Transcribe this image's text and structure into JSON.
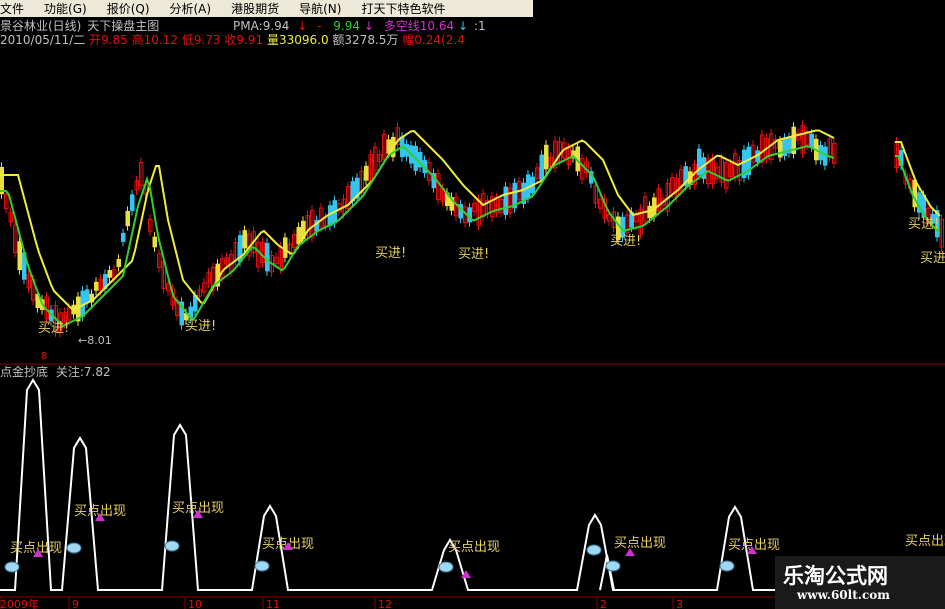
{
  "menu": [
    {
      "label": "文件",
      "name": "menu-file",
      "width": 0
    },
    {
      "label": "功能(G)",
      "name": "menu-function"
    },
    {
      "label": "报价(Q)",
      "name": "menu-quote"
    },
    {
      "label": "分析(A)",
      "name": "menu-analysis"
    },
    {
      "label": "港股期货",
      "name": "menu-hk-futures"
    },
    {
      "label": "导航(N)",
      "name": "menu-navigation"
    },
    {
      "label": "打天下特色软件",
      "name": "menu-special-software"
    }
  ],
  "header": {
    "title": "景谷林业(日线)",
    "chart_name": "天下操盘主图",
    "pma_label": "PMA:",
    "pma_value": "9.94",
    "pma_sep": "-",
    "pma2_value": "9.94",
    "trend_label": "多空线",
    "trend_value": "10.64",
    "date": "2010/05/11/二",
    "open_label": "开",
    "open": "9.85",
    "high_label": "高",
    "high": "10.12",
    "low_label": "低",
    "low": "9.73",
    "close_label": "收",
    "close": "9.91",
    "volume_label": "量",
    "volume": "33096.0",
    "amount_label": "额",
    "amount": "3278.5万",
    "change_label": "幅",
    "change": "0.24(2.4"
  },
  "colors": {
    "up": "#e01010",
    "down": "#33c4f0",
    "ma_yellow": "#f0ec3a",
    "ma_green": "#2fd02f",
    "signal_magenta": "#d030d0",
    "label_gold": "#e8d060",
    "ind_line": "#ffffff"
  },
  "main": {
    "buy_label": "买进!",
    "low_price_label": "←8.01",
    "buy_signals": [
      "买进!",
      "买进!",
      "买进!",
      "买进!",
      "买进!",
      "买进!",
      "买进!"
    ]
  },
  "indicator": {
    "marker": "8",
    "name": "点金抄底",
    "focus_label": "关注:",
    "focus_value": "7.82",
    "signal_text": "买点出现"
  },
  "time_axis": {
    "labels": [
      "2009年",
      "9",
      "10",
      "11",
      "12",
      "2",
      "3"
    ]
  },
  "watermark": {
    "main": "乐淘公式网",
    "url": "www.60lt.com"
  }
}
